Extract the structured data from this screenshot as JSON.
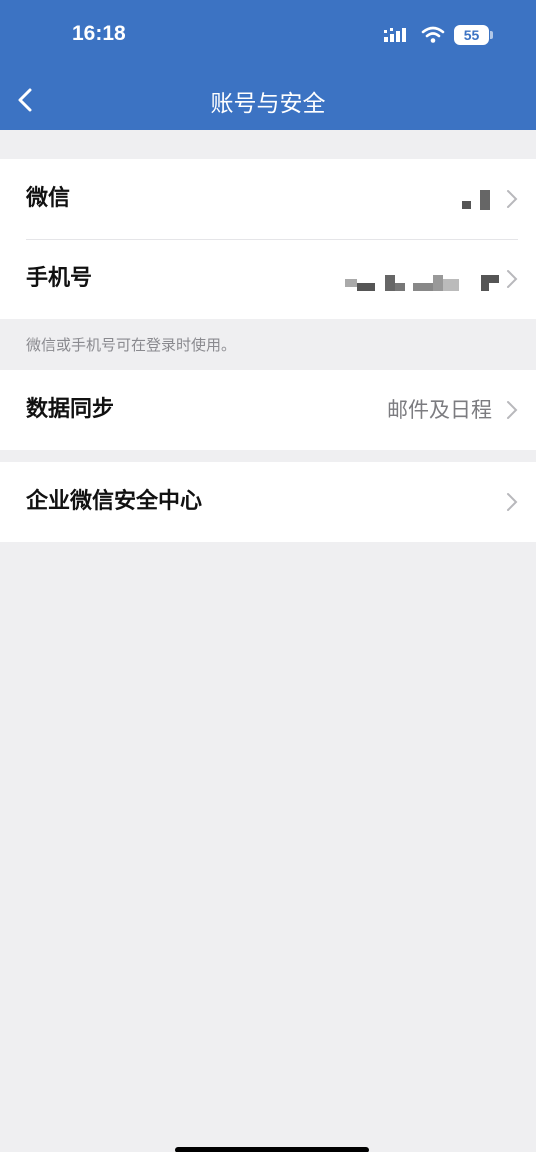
{
  "status_bar": {
    "time": "16:18",
    "battery": "55"
  },
  "nav": {
    "title": "账号与安全"
  },
  "rows": {
    "wechat": {
      "label": "微信"
    },
    "phone": {
      "label": "手机号"
    },
    "sync": {
      "label": "数据同步",
      "value": "邮件及日程"
    },
    "security_center": {
      "label": "企业微信安全中心"
    }
  },
  "note": "微信或手机号可在登录时使用。",
  "colors": {
    "header": "#3c73c3",
    "background": "#efeff1",
    "card": "#ffffff"
  }
}
